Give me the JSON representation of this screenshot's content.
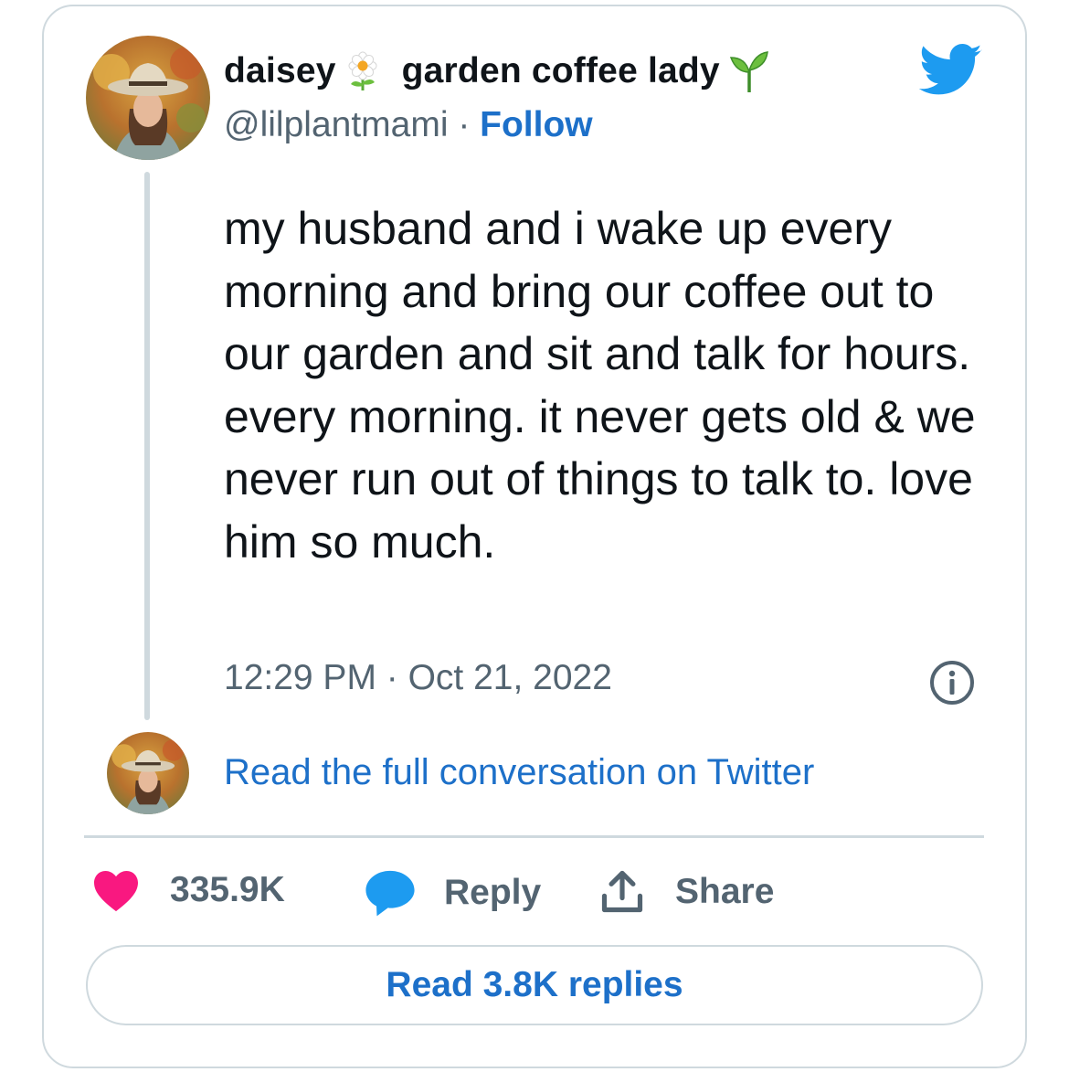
{
  "tweet": {
    "author": {
      "name_part1": "daisey",
      "name_part2": "garden coffee lady",
      "name_emojis": [
        "daisy-flower-icon",
        "seedling-icon"
      ],
      "handle": "@lilplantmami",
      "separator": " · ",
      "follow_label": "Follow"
    },
    "text": "my husband and i wake up every morning and bring our coffee out to our garden and sit and talk for hours. every morning. it never gets old & we never run out of things to talk to. love him so much.",
    "timestamp": "12:29 PM · Oct 21, 2022",
    "read_conversation_label": "Read the full conversation on Twitter",
    "actions": {
      "likes_count": "335.9K",
      "reply_label": "Reply",
      "share_label": "Share"
    },
    "read_replies_label": "Read 3.8K replies"
  },
  "colors": {
    "twitter_blue": "#1d9bf0",
    "link_blue": "#1d70c9",
    "like_pink": "#f91880",
    "secondary_text": "#536471",
    "border": "#cfd9de"
  }
}
